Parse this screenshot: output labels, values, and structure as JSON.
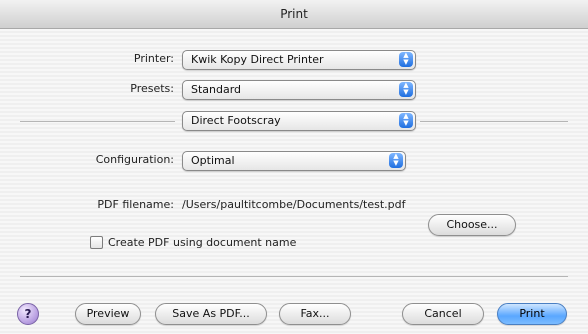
{
  "window": {
    "title": "Print"
  },
  "printer": {
    "label": "Printer:",
    "value": "Kwik Kopy Direct Printer"
  },
  "presets": {
    "label": "Presets:",
    "value": "Standard"
  },
  "panel": {
    "value": "Direct Footscray"
  },
  "configuration": {
    "label": "Configuration:",
    "value": "Optimal"
  },
  "pdf": {
    "filename_label": "PDF filename:",
    "filename_value": "/Users/paultitcombe/Documents/test.pdf",
    "choose_label": "Choose..."
  },
  "checkbox": {
    "label": "Create PDF using document name",
    "checked": false
  },
  "footer": {
    "help_label": "?",
    "preview_label": "Preview",
    "save_pdf_label": "Save As PDF...",
    "fax_label": "Fax...",
    "cancel_label": "Cancel",
    "print_label": "Print"
  },
  "icons": {
    "popup_arrows": "up-down-arrows-icon",
    "help": "help-icon"
  },
  "colors": {
    "accent": "#2f7ff0",
    "default_button": "#5aa7ff"
  }
}
